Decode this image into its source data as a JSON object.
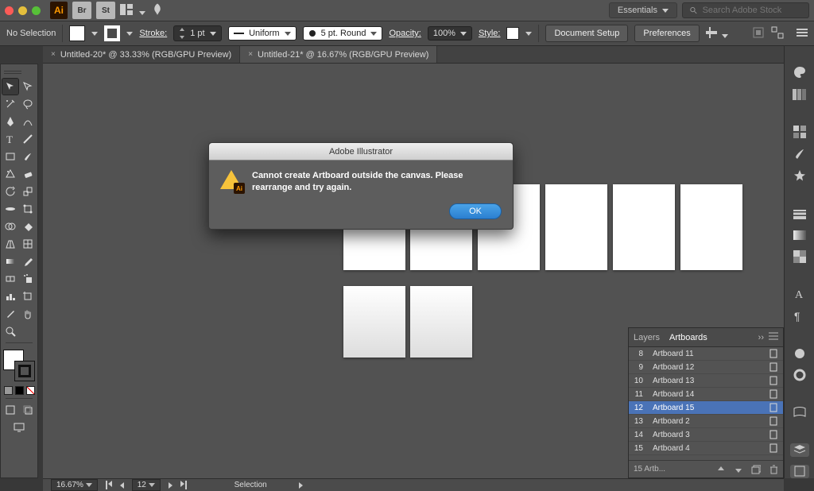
{
  "menubar": {
    "ai_logo": "Ai",
    "ext1": "Br",
    "ext2": "St",
    "workspace": "Essentials",
    "search_placeholder": "Search Adobe Stock"
  },
  "controlbar": {
    "selection": "No Selection",
    "stroke_label": "Stroke:",
    "stroke_weight": "1 pt",
    "stroke_profile": "Uniform",
    "brush_label": "5 pt. Round",
    "opacity_label": "Opacity:",
    "opacity_value": "100%",
    "style_label": "Style:",
    "document_setup": "Document Setup",
    "preferences": "Preferences"
  },
  "tabs": [
    {
      "label": "Untitled-20* @ 33.33% (RGB/GPU Preview)",
      "active": false
    },
    {
      "label": "Untitled-21* @ 16.67% (RGB/GPU Preview)",
      "active": true
    }
  ],
  "panel": {
    "tab_layers": "Layers",
    "tab_artboards": "Artboards",
    "rows": [
      {
        "n": "8",
        "name": "Artboard 11"
      },
      {
        "n": "9",
        "name": "Artboard 12"
      },
      {
        "n": "10",
        "name": "Artboard 13"
      },
      {
        "n": "11",
        "name": "Artboard 14"
      },
      {
        "n": "12",
        "name": "Artboard 15",
        "selected": true
      },
      {
        "n": "13",
        "name": "Artboard 2"
      },
      {
        "n": "14",
        "name": "Artboard 3"
      },
      {
        "n": "15",
        "name": "Artboard 4"
      }
    ],
    "footer_count": "15 Artb..."
  },
  "statusbar": {
    "zoom": "16.67%",
    "artboard_index": "12",
    "tool": "Selection"
  },
  "dialog": {
    "title": "Adobe Illustrator",
    "message": "Cannot create Artboard outside the canvas. Please rearrange and try again.",
    "ok": "OK"
  }
}
